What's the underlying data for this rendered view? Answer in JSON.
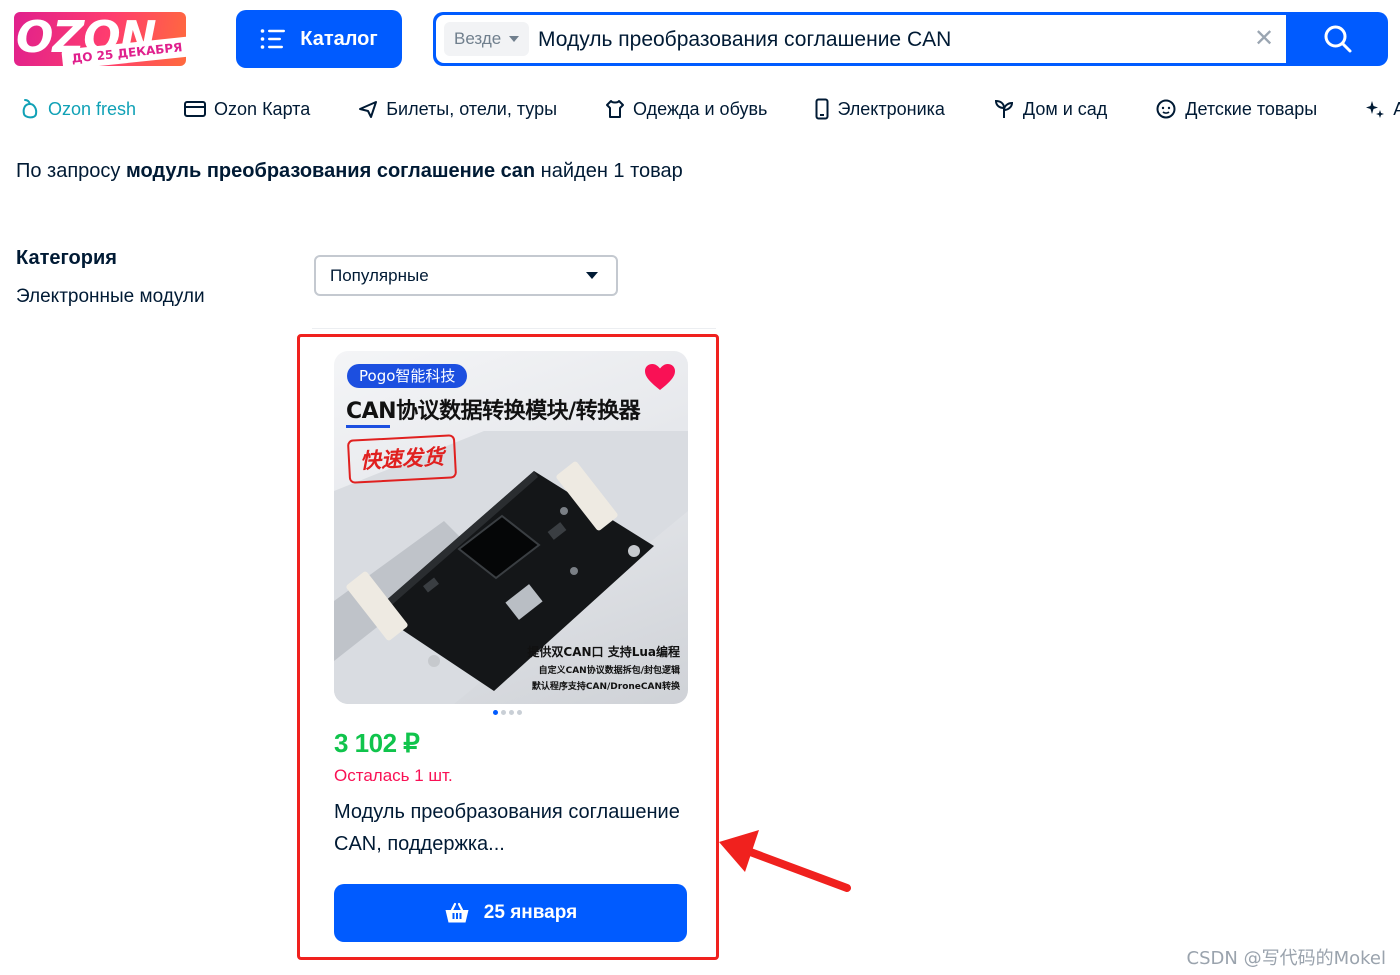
{
  "logo": {
    "word": "OZON",
    "promo": "ДО 25 ДЕКАБРЯ"
  },
  "header": {
    "catalog_label": "Каталог",
    "search": {
      "scope": "Везде",
      "query": "Модуль преобразования соглашение CAN",
      "clear": "✕"
    }
  },
  "nav": [
    {
      "label": "Ozon fresh",
      "icon": "fresh-icon"
    },
    {
      "label": "Ozon Карта",
      "icon": "card-icon"
    },
    {
      "label": "Билеты, отели, туры",
      "icon": "plane-icon"
    },
    {
      "label": "Одежда и обувь",
      "icon": "clothes-icon"
    },
    {
      "label": "Электроника",
      "icon": "phone-icon"
    },
    {
      "label": "Дом и сад",
      "icon": "plant-icon"
    },
    {
      "label": "Детские товары",
      "icon": "kids-icon"
    },
    {
      "label": "Ак",
      "icon": "sparkle-icon"
    }
  ],
  "results": {
    "prefix": "По запросу ",
    "query": "модуль преобразования соглашение can",
    "suffix": " найден 1 товар"
  },
  "filters": {
    "category_title": "Категория",
    "category_value": "Электронные модули",
    "sort_selected": "Популярные"
  },
  "product": {
    "image": {
      "brand": "Pogo智能科技",
      "headline": "CAN协议数据转换模块/转换器",
      "stamp": "快速发货",
      "line1": "提供双CAN口  支持Lua编程",
      "line2": "自定义CAN协议数据拆包/封包逻辑",
      "line3": "默认程序支持CAN/DroneCAN转换"
    },
    "price": "3 102 ₽",
    "stock": "Осталась 1 шт.",
    "title": "Модуль преобразования соглашение CAN, поддержка...",
    "delivery": "25 января",
    "gallery": {
      "count": 4,
      "active": 1
    }
  },
  "watermark": "CSDN @写代码的Mokel",
  "colors": {
    "brand_blue": "#005bff",
    "price_green": "#10c44c",
    "stock_red": "#f91155",
    "highlight_red": "#f0211e"
  }
}
